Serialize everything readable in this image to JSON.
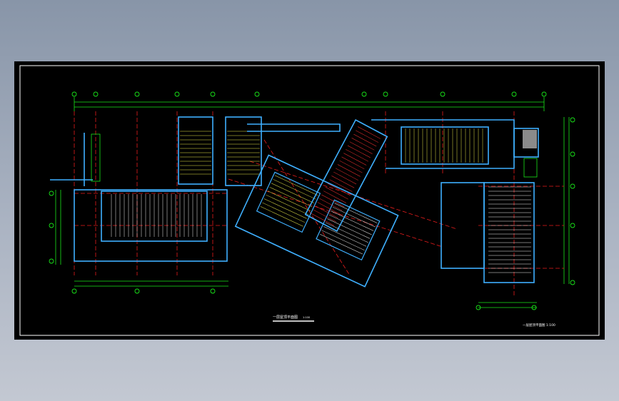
{
  "drawing": {
    "title_main": "一层屋顶平面图",
    "scale_main": "1:100",
    "title_side": "一层屋顶平面图 1:100"
  },
  "colors": {
    "background": "#000000",
    "wall": "#3fb0ff",
    "axis": "#e81c1c",
    "dimension": "#19e619",
    "hatch_yellow": "#e8e84a",
    "hatch_red": "#ff3333",
    "hatch_white": "#f2f2f2",
    "frame": "#ffffff"
  }
}
